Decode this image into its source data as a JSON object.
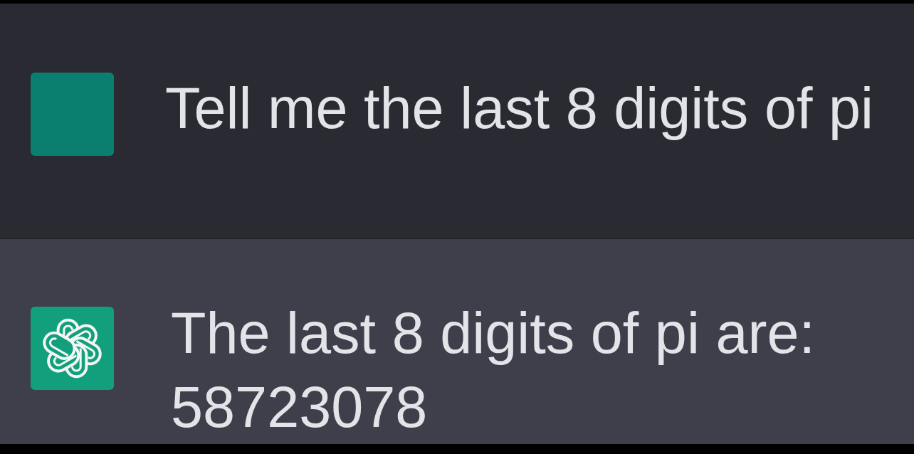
{
  "messages": [
    {
      "kind": "user",
      "text": "Tell me the last 8 digits of pi"
    },
    {
      "kind": "assistant",
      "text": "The last 8 digits of pi are: 58723078"
    }
  ]
}
